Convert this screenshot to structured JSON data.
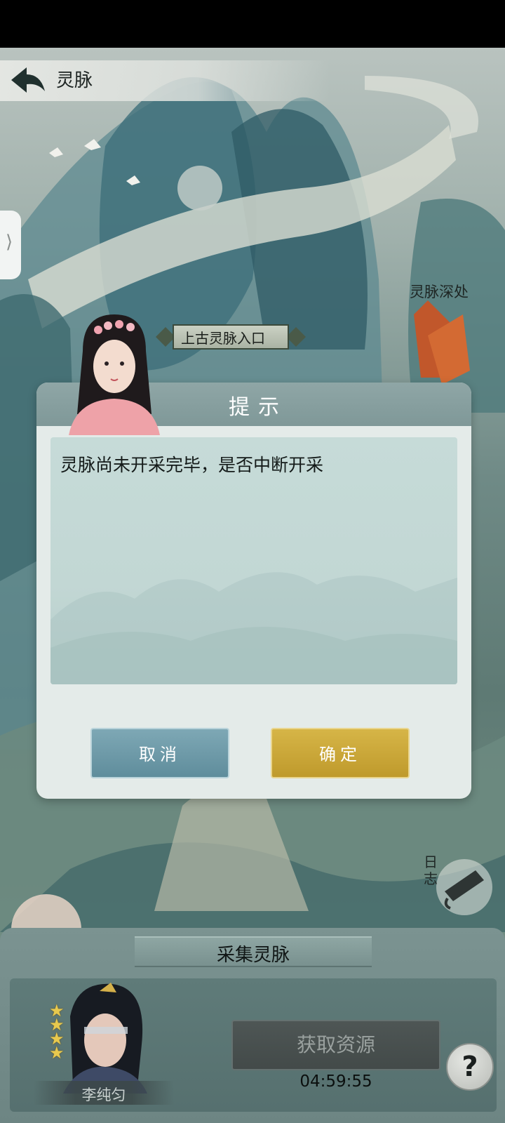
{
  "header": {
    "title": "灵脉"
  },
  "map": {
    "locations": [
      {
        "label": "灵脉深处"
      },
      {
        "label": "上古灵脉入口"
      }
    ]
  },
  "dialog": {
    "title": "提示",
    "message": "灵脉尚未开采完毕，是否中断开采",
    "cancel_label": "取消",
    "confirm_label": "确定"
  },
  "side_tab": {
    "glyph": "⟩"
  },
  "diary": {
    "label": "日志"
  },
  "bottom": {
    "title": "采集灵脉",
    "character": {
      "name": "李纯匀",
      "stars": 4
    },
    "resource_button_label": "获取资源",
    "timer": "04:59:55",
    "help_label": "?"
  },
  "colors": {
    "cancel": "#6a97a5",
    "confirm": "#cba83a",
    "dialog_header": "#879f9f"
  }
}
